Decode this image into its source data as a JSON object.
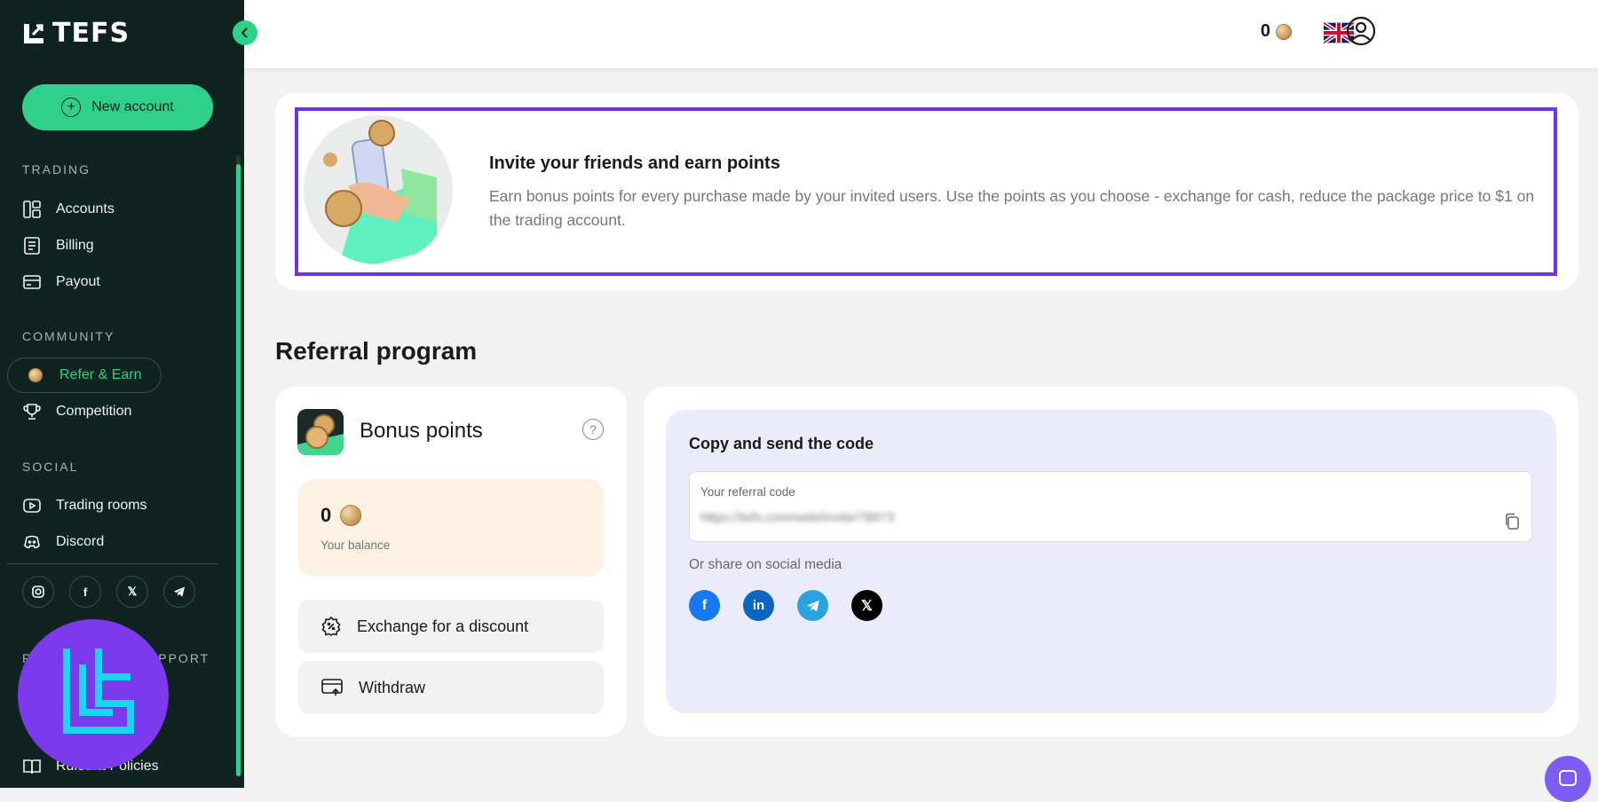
{
  "brand": {
    "name": "TEFS"
  },
  "sidebar": {
    "new_account_label": "New account",
    "sections": {
      "trading": "TRADING",
      "community": "COMMUNITY",
      "social": "SOCIAL",
      "support": "RESOURCES & SUPPORT"
    },
    "items": {
      "accounts": "Accounts",
      "billing": "Billing",
      "payout": "Payout",
      "refer_earn": "Refer & Earn",
      "competition": "Competition",
      "trading_rooms": "Trading rooms",
      "discord": "Discord",
      "rules_policies": "Rules & Policies"
    },
    "social_icons": [
      "instagram-icon",
      "facebook-icon",
      "x-icon",
      "telegram-icon"
    ]
  },
  "topbar": {
    "points": "0",
    "language": "English (UK)"
  },
  "banner": {
    "title": "Invite your friends and earn points",
    "description": "Earn bonus points for every purchase made by your invited users. Use the points as you choose - exchange for cash, reduce the package price to $1 on the trading account."
  },
  "referral": {
    "title": "Referral program",
    "bonus": {
      "title": "Bonus points",
      "balance_value": "0",
      "balance_label": "Your balance",
      "exchange_label": "Exchange for a discount",
      "withdraw_label": "Withdraw"
    },
    "share": {
      "title": "Copy and send the code",
      "code_label": "Your referral code",
      "code_value": "https://tefs.com/web/invite/78973",
      "social_label": "Or share on social media",
      "icons": [
        "facebook-icon",
        "linkedin-icon",
        "telegram-icon",
        "x-icon"
      ]
    }
  },
  "colors": {
    "sidebar_bg": "#0f2420",
    "accent_green": "#2fd08a",
    "highlight_border": "#6d35e6",
    "balance_bg": "#fcf1e2",
    "share_bg": "#ecebfb"
  }
}
